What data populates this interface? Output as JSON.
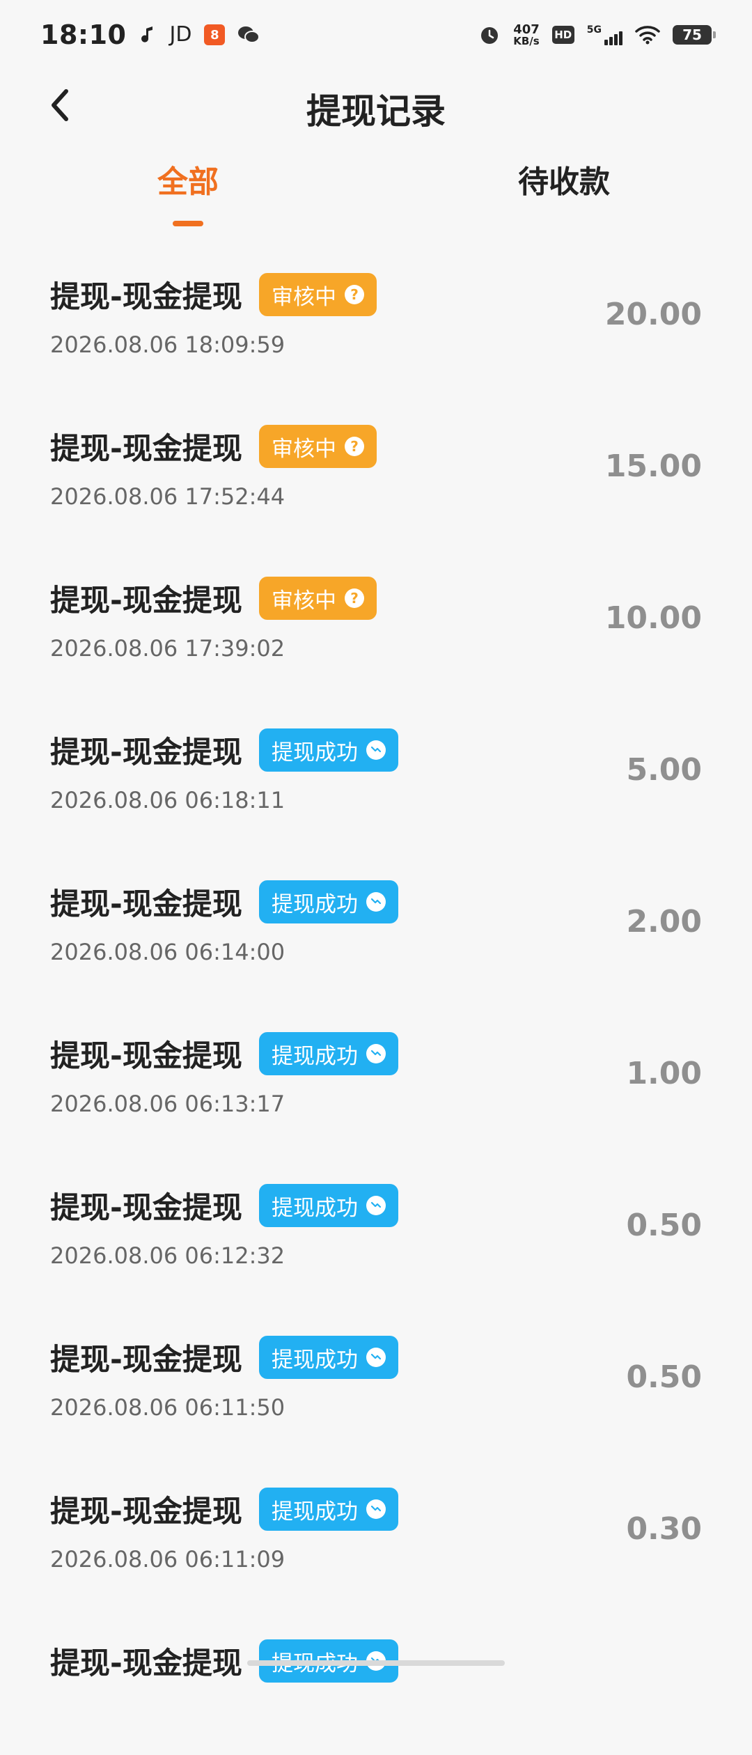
{
  "status_bar": {
    "time": "18:10",
    "jd_label": "JD",
    "app_badge": "8",
    "speed_value": "407",
    "speed_unit": "KB/s",
    "hd_label": "HD",
    "network_label": "5G",
    "battery": "75"
  },
  "header": {
    "title": "提现记录"
  },
  "tabs": [
    {
      "label": "全部",
      "active": true
    },
    {
      "label": "待收款",
      "active": false
    }
  ],
  "badge_texts": {
    "review": "审核中",
    "success": "提现成功"
  },
  "records": [
    {
      "title": "提现-现金提现",
      "status": "审核中",
      "status_type": "review",
      "time": "2026.08.06 18:09:59",
      "amount": "20.00"
    },
    {
      "title": "提现-现金提现",
      "status": "审核中",
      "status_type": "review",
      "time": "2026.08.06 17:52:44",
      "amount": "15.00"
    },
    {
      "title": "提现-现金提现",
      "status": "审核中",
      "status_type": "review",
      "time": "2026.08.06 17:39:02",
      "amount": "10.00"
    },
    {
      "title": "提现-现金提现",
      "status": "提现成功",
      "status_type": "success",
      "time": "2026.08.06 06:18:11",
      "amount": "5.00"
    },
    {
      "title": "提现-现金提现",
      "status": "提现成功",
      "status_type": "success",
      "time": "2026.08.06 06:14:00",
      "amount": "2.00"
    },
    {
      "title": "提现-现金提现",
      "status": "提现成功",
      "status_type": "success",
      "time": "2026.08.06 06:13:17",
      "amount": "1.00"
    },
    {
      "title": "提现-现金提现",
      "status": "提现成功",
      "status_type": "success",
      "time": "2026.08.06 06:12:32",
      "amount": "0.50"
    },
    {
      "title": "提现-现金提现",
      "status": "提现成功",
      "status_type": "success",
      "time": "2026.08.06 06:11:50",
      "amount": "0.50"
    },
    {
      "title": "提现-现金提现",
      "status": "提现成功",
      "status_type": "success",
      "time": "2026.08.06 06:11:09",
      "amount": "0.30"
    },
    {
      "title": "提现-现金提现",
      "status": "提现成功",
      "status_type": "success",
      "time": "",
      "amount": ""
    }
  ],
  "colors": {
    "accent": "#f07020",
    "review_badge": "#f7a628",
    "success_badge": "#22b0f2",
    "amount_text": "#8f8f8f"
  }
}
